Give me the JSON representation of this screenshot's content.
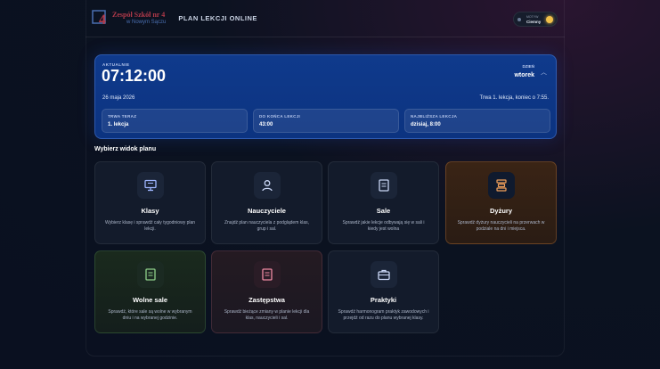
{
  "header": {
    "logo_line1": "Zespół Szkół nr 4",
    "logo_line2": "w Nowym Sączu",
    "app_title": "PLAN LEKCJI ONLINE",
    "theme_small": "MOTYW",
    "theme_value": "Ciemny"
  },
  "clock": {
    "now_label": "AKTUALNIE",
    "time": "07:12:00",
    "day_label": "DZIEŃ",
    "day_value": "wtorek",
    "date": "26 maja 2026",
    "status": "Trwa 1. lekcja, koniec o 7:55.",
    "stats": [
      {
        "label": "TRWA TERAZ",
        "value": "1. lekcja"
      },
      {
        "label": "DO KOŃCA LEKCJI",
        "value": "43:00"
      },
      {
        "label": "NAJBLIŻSZA LEKCJA",
        "value": "dzisiaj, 8:00"
      }
    ]
  },
  "section_title": "Wybierz widok planu",
  "tiles": [
    {
      "title": "Klasy",
      "desc": "Wybierz klasę i sprawdź cały tygodniowy plan lekcji."
    },
    {
      "title": "Nauczyciele",
      "desc": "Znajdź plan nauczyciela z podglądem klas, grup i sal."
    },
    {
      "title": "Sale",
      "desc": "Sprawdź jakie lekcje odbywają się w sali i kiedy jest wolna"
    },
    {
      "title": "Dyżury",
      "desc": "Sprawdź dyżury nauczycieli na przerwach w podziale na dni i miejsca."
    },
    {
      "title": "Wolne sale",
      "desc": "Sprawdź, które sale są wolne w wybranym dniu i na wybranej godzinie."
    },
    {
      "title": "Zastępstwa",
      "desc": "Sprawdź bieżące zmiany w planie lekcji dla klas, nauczycieli i sal."
    },
    {
      "title": "Praktyki",
      "desc": "Sprawdź harmonogram praktyk zawodowych i przejdź od razu do planu wybranej klasy."
    }
  ],
  "colors": {
    "accent_blue": "#0f3a8c",
    "highlight_orange": "#3a2415",
    "icon_blue": "#9fb6ff",
    "icon_orange": "#f2a05a",
    "icon_green": "#8fd08a",
    "icon_rose": "#f08aa3"
  }
}
